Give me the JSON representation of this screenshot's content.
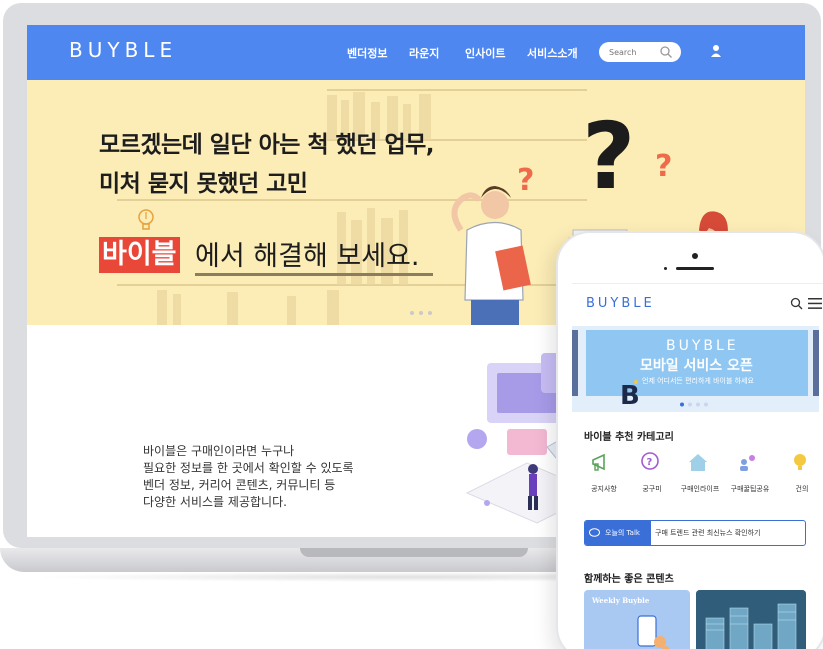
{
  "laptop": {
    "nav": {
      "logo": "BUYBLE",
      "links": [
        "벤더정보",
        "라운지",
        "인사이트",
        "서비스소개"
      ],
      "search_placeholder": "Search"
    },
    "hero": {
      "line1": "모르겠는데 일단 아는 척 했던 업무,",
      "line2": "미처 묻지 못했던 고민",
      "brand": "바이블",
      "rest": "에서 해결해 보세요."
    },
    "intro": {
      "lines": [
        "바이블은 구매인이라면 누구나",
        "필요한 정보를 한 곳에서 확인할 수 있도록",
        "벤더 정보, 커리어 콘텐츠, 커뮤니티 등",
        "다양한 서비스를 제공합니다."
      ]
    }
  },
  "phone": {
    "logo": "BUYBLE",
    "banner": {
      "logo": "BUYBLE",
      "title": "모바일 서비스 오픈",
      "subtitle": "언제 어디서든 편리하게 바이블 하세요"
    },
    "section_categories": "바이블 추천 카테고리",
    "categories": [
      "공지사항",
      "궁구미",
      "구매인라이프",
      "구매꿀팁공유",
      "건의"
    ],
    "talk": {
      "tag": "오늘의 Talk",
      "text": "구매 트렌드 관련 최신뉴스 확인하기"
    },
    "section_contents": "함께하는 좋은 콘텐츠",
    "card1_title": "Weekly Buyble"
  },
  "colors": {
    "nav_blue": "#4f87f0",
    "hero_yellow": "#fcecb6",
    "brand_red": "#e94839",
    "mobile_blue": "#3a6fd8"
  }
}
